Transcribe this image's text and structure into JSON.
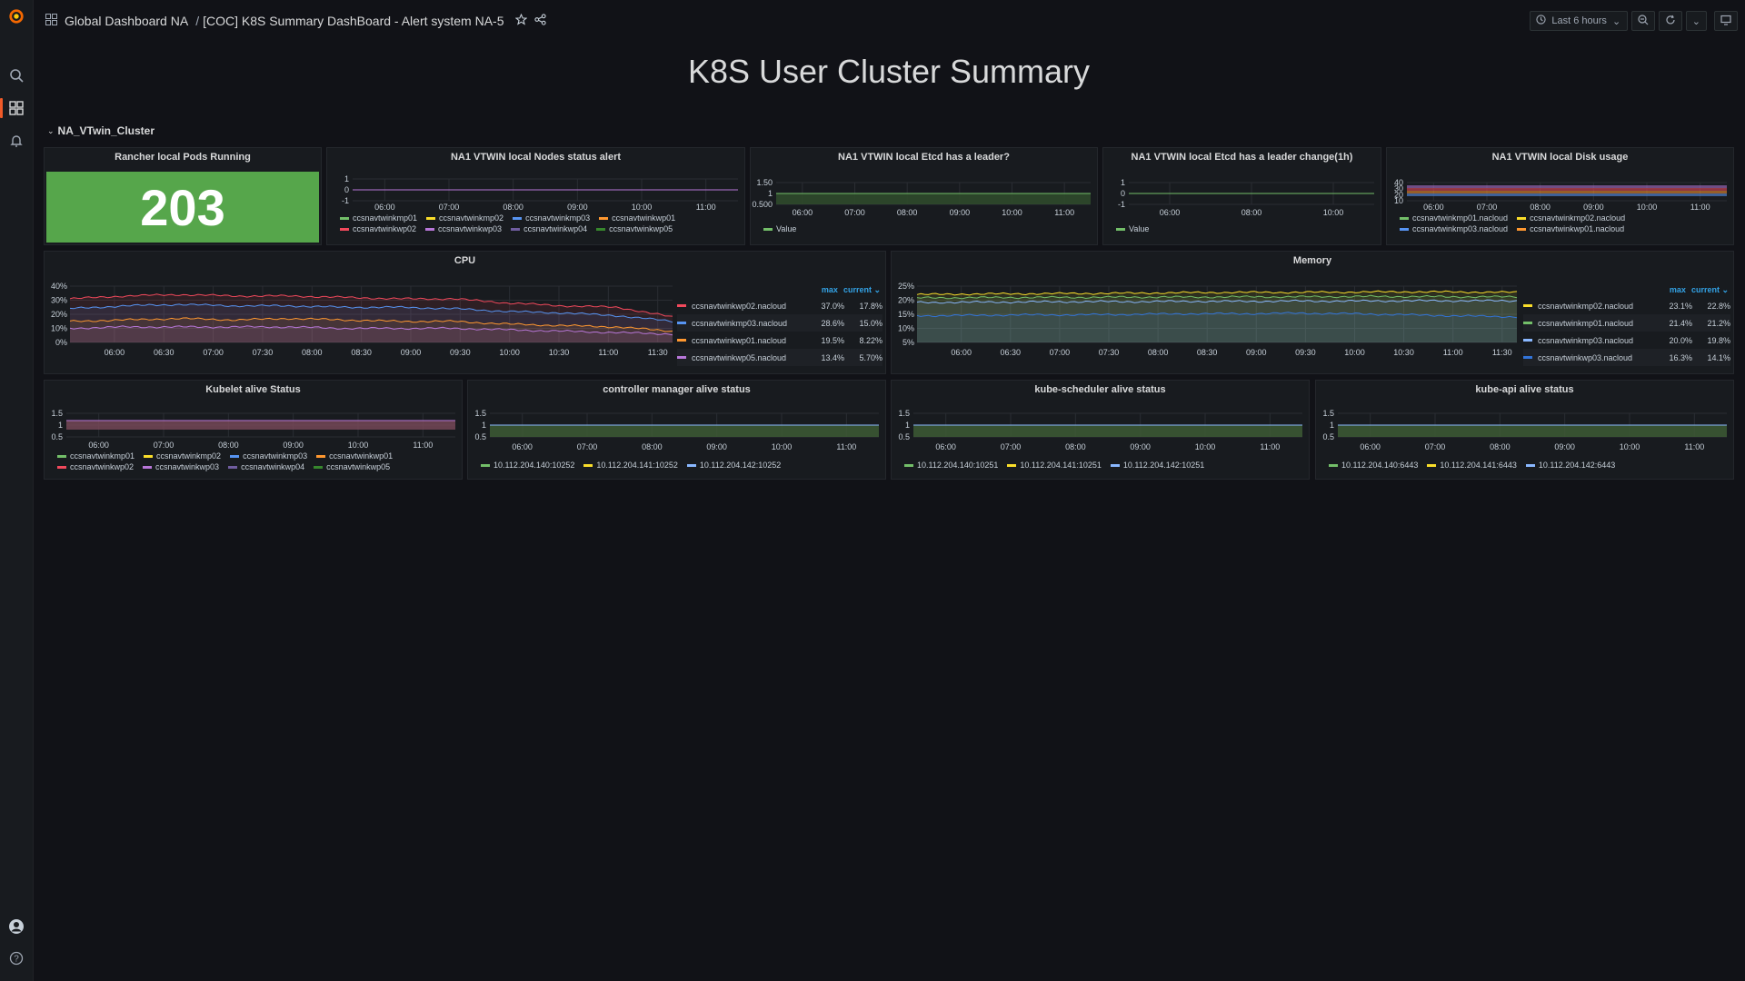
{
  "topbar": {
    "folder": "Global Dashboard NA",
    "separator": "/",
    "dashboard": "[COC] K8S Summary DashBoard - Alert system NA-5",
    "time_range": "Last 6 hours"
  },
  "dashboard_title": "K8S User Cluster Summary",
  "row_title": "NA_VTwin_Cluster",
  "panels": {
    "pods": {
      "title": "Rancher local Pods Running",
      "value": "203",
      "color": "#56a64b"
    },
    "nodes": {
      "title": "NA1 VTWIN local Nodes status alert",
      "y_ticks": [
        "1",
        "0",
        "-1"
      ],
      "x_ticks": [
        "06:00",
        "07:00",
        "08:00",
        "09:00",
        "10:00",
        "11:00"
      ],
      "legend": [
        {
          "name": "ccsnavtwinkmp01",
          "color": "#73bf69"
        },
        {
          "name": "ccsnavtwinkmp02",
          "color": "#fade2a"
        },
        {
          "name": "ccsnavtwinkmp03",
          "color": "#5794f2"
        },
        {
          "name": "ccsnavtwinkwp01",
          "color": "#ff9830"
        },
        {
          "name": "ccsnavtwinkwp02",
          "color": "#f2495c"
        },
        {
          "name": "ccsnavtwinkwp03",
          "color": "#b877d9"
        },
        {
          "name": "ccsnavtwinkwp04",
          "color": "#705da0"
        },
        {
          "name": "ccsnavtwinkwp05",
          "color": "#37872d"
        }
      ]
    },
    "etcd_leader": {
      "title": "NA1 VTWIN local Etcd has a leader?",
      "y_ticks": [
        "1.50",
        "1",
        "0.500"
      ],
      "x_ticks": [
        "06:00",
        "07:00",
        "08:00",
        "09:00",
        "10:00",
        "11:00"
      ],
      "legend": [
        {
          "name": "Value",
          "color": "#73bf69"
        }
      ]
    },
    "etcd_change": {
      "title": "NA1 VTWIN local Etcd has a leader change(1h)",
      "y_ticks": [
        "1",
        "0",
        "-1"
      ],
      "x_ticks": [
        "06:00",
        "08:00",
        "10:00"
      ],
      "legend": [
        {
          "name": "Value",
          "color": "#73bf69"
        }
      ]
    },
    "disk": {
      "title": "NA1 VTWIN local Disk usage",
      "y_ticks": [
        "40",
        "30",
        "20",
        "10"
      ],
      "x_ticks": [
        "06:00",
        "07:00",
        "08:00",
        "09:00",
        "10:00",
        "11:00"
      ],
      "legend": [
        {
          "name": "ccsnavtwinkmp01.nacloud",
          "color": "#73bf69"
        },
        {
          "name": "ccsnavtwinkmp02.nacloud",
          "color": "#fade2a"
        },
        {
          "name": "ccsnavtwinkmp03.nacloud",
          "color": "#5794f2"
        },
        {
          "name": "ccsnavtwinkwp01.nacloud",
          "color": "#ff9830"
        }
      ]
    },
    "cpu": {
      "title": "CPU",
      "y_ticks": [
        "40%",
        "30%",
        "20%",
        "10%",
        "0%"
      ],
      "x_ticks": [
        "06:00",
        "06:30",
        "07:00",
        "07:30",
        "08:00",
        "08:30",
        "09:00",
        "09:30",
        "10:00",
        "10:30",
        "11:00",
        "11:30"
      ],
      "legend_headers": {
        "max": "max",
        "current": "current"
      },
      "rows": [
        {
          "name": "ccsnavtwinkwp02.nacloud",
          "color": "#f2495c",
          "max": "37.0%",
          "current": "17.8%"
        },
        {
          "name": "ccsnavtwinkmp03.nacloud",
          "color": "#5794f2",
          "max": "28.6%",
          "current": "15.0%"
        },
        {
          "name": "ccsnavtwinkwp01.nacloud",
          "color": "#ff9830",
          "max": "19.5%",
          "current": "8.22%"
        },
        {
          "name": "ccsnavtwinkwp05.nacloud",
          "color": "#b877d9",
          "max": "13.4%",
          "current": "5.70%"
        }
      ]
    },
    "memory": {
      "title": "Memory",
      "y_ticks": [
        "25%",
        "20%",
        "15%",
        "10%",
        "5%"
      ],
      "x_ticks": [
        "06:00",
        "06:30",
        "07:00",
        "07:30",
        "08:00",
        "08:30",
        "09:00",
        "09:30",
        "10:00",
        "10:30",
        "11:00",
        "11:30"
      ],
      "legend_headers": {
        "max": "max",
        "current": "current"
      },
      "rows": [
        {
          "name": "ccsnavtwinkmp02.nacloud",
          "color": "#fade2a",
          "max": "23.1%",
          "current": "22.8%"
        },
        {
          "name": "ccsnavtwinkmp01.nacloud",
          "color": "#73bf69",
          "max": "21.4%",
          "current": "21.2%"
        },
        {
          "name": "ccsnavtwinkmp03.nacloud",
          "color": "#8ab8ff",
          "max": "20.0%",
          "current": "19.8%"
        },
        {
          "name": "ccsnavtwinkwp03.nacloud",
          "color": "#3274d9",
          "max": "16.3%",
          "current": "14.1%"
        }
      ]
    },
    "kubelet": {
      "title": "Kubelet alive Status",
      "y_ticks": [
        "1.5",
        "1",
        "0.5"
      ],
      "x_ticks": [
        "06:00",
        "07:00",
        "08:00",
        "09:00",
        "10:00",
        "11:00"
      ],
      "legend": [
        {
          "name": "ccsnavtwinkmp01",
          "color": "#73bf69"
        },
        {
          "name": "ccsnavtwinkmp02",
          "color": "#fade2a"
        },
        {
          "name": "ccsnavtwinkmp03",
          "color": "#5794f2"
        },
        {
          "name": "ccsnavtwinkwp01",
          "color": "#ff9830"
        },
        {
          "name": "ccsnavtwinkwp02",
          "color": "#f2495c"
        },
        {
          "name": "ccsnavtwinkwp03",
          "color": "#b877d9"
        },
        {
          "name": "ccsnavtwinkwp04",
          "color": "#705da0"
        },
        {
          "name": "ccsnavtwinkwp05",
          "color": "#37872d"
        }
      ]
    },
    "controller": {
      "title": "controller manager alive status",
      "y_ticks": [
        "1.5",
        "1",
        "0.5"
      ],
      "x_ticks": [
        "06:00",
        "07:00",
        "08:00",
        "09:00",
        "10:00",
        "11:00"
      ],
      "legend": [
        {
          "name": "10.112.204.140:10252",
          "color": "#73bf69"
        },
        {
          "name": "10.112.204.141:10252",
          "color": "#fade2a"
        },
        {
          "name": "10.112.204.142:10252",
          "color": "#8ab8ff"
        }
      ]
    },
    "scheduler": {
      "title": "kube-scheduler alive status",
      "y_ticks": [
        "1.5",
        "1",
        "0.5"
      ],
      "x_ticks": [
        "06:00",
        "07:00",
        "08:00",
        "09:00",
        "10:00",
        "11:00"
      ],
      "legend": [
        {
          "name": "10.112.204.140:10251",
          "color": "#73bf69"
        },
        {
          "name": "10.112.204.141:10251",
          "color": "#fade2a"
        },
        {
          "name": "10.112.204.142:10251",
          "color": "#8ab8ff"
        }
      ]
    },
    "api": {
      "title": "kube-api alive status",
      "y_ticks": [
        "1.5",
        "1",
        "0.5"
      ],
      "x_ticks": [
        "06:00",
        "07:00",
        "08:00",
        "09:00",
        "10:00",
        "11:00"
      ],
      "legend": [
        {
          "name": "10.112.204.140:6443",
          "color": "#73bf69"
        },
        {
          "name": "10.112.204.141:6443",
          "color": "#fade2a"
        },
        {
          "name": "10.112.204.142:6443",
          "color": "#8ab8ff"
        }
      ]
    }
  },
  "chart_data": [
    {
      "type": "line",
      "title": "CPU",
      "ylim": [
        0,
        40
      ],
      "x": [
        "06:00",
        "06:30",
        "07:00",
        "07:30",
        "08:00",
        "08:30",
        "09:00",
        "09:30",
        "10:00",
        "10:30",
        "11:00",
        "11:30"
      ],
      "series": [
        {
          "name": "ccsnavtwinkwp02.nacloud",
          "values": [
            31,
            33,
            34,
            33,
            33,
            32,
            31,
            31,
            28,
            26,
            25,
            18
          ]
        },
        {
          "name": "ccsnavtwinkmp03.nacloud",
          "values": [
            24,
            26,
            27,
            26,
            26,
            25,
            25,
            24,
            22,
            21,
            19,
            15
          ]
        },
        {
          "name": "ccsnavtwinkwp01.nacloud",
          "values": [
            15,
            16,
            17,
            16,
            17,
            16,
            15,
            15,
            13,
            12,
            11,
            8
          ]
        },
        {
          "name": "ccsnavtwinkwp05.nacloud",
          "values": [
            10,
            11,
            11,
            11,
            11,
            10,
            10,
            10,
            9,
            8,
            7,
            6
          ]
        }
      ]
    },
    {
      "type": "line",
      "title": "Memory",
      "ylim": [
        5,
        25
      ],
      "x": [
        "06:00",
        "06:30",
        "07:00",
        "07:30",
        "08:00",
        "08:30",
        "09:00",
        "09:30",
        "10:00",
        "10:30",
        "11:00",
        "11:30"
      ],
      "series": [
        {
          "name": "ccsnavtwinkmp02.nacloud",
          "values": [
            22.0,
            22.2,
            22.3,
            22.4,
            22.5,
            22.7,
            22.8,
            22.8,
            22.9,
            23.0,
            22.9,
            22.8
          ]
        },
        {
          "name": "ccsnavtwinkmp01.nacloud",
          "values": [
            20.8,
            20.9,
            21.0,
            21.0,
            21.1,
            21.1,
            21.2,
            21.2,
            21.3,
            21.3,
            21.2,
            21.2
          ]
        },
        {
          "name": "ccsnavtwinkmp03.nacloud",
          "values": [
            19.2,
            19.3,
            19.4,
            19.5,
            19.5,
            19.6,
            19.6,
            19.7,
            19.7,
            19.8,
            19.8,
            19.8
          ]
        },
        {
          "name": "ccsnavtwinkwp03.nacloud",
          "values": [
            14.5,
            14.6,
            14.8,
            14.8,
            15.0,
            15.2,
            15.2,
            15.4,
            15.2,
            14.8,
            14.4,
            14.1
          ]
        }
      ]
    }
  ]
}
